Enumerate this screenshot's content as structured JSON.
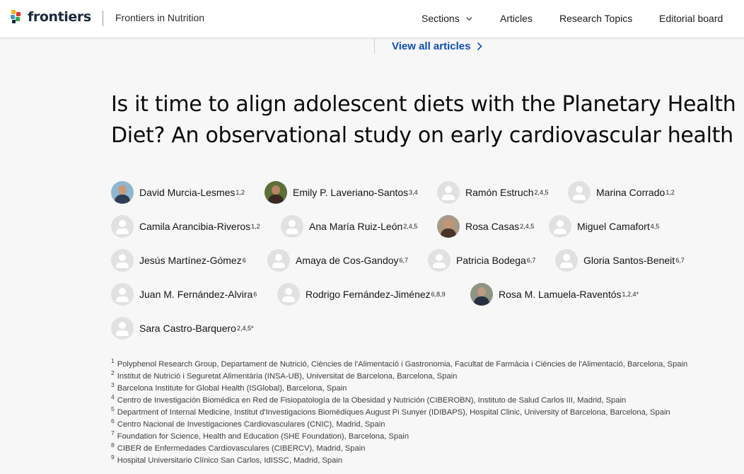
{
  "header": {
    "logo_text": "frontiers",
    "journal": "Frontiers in Nutrition",
    "nav": {
      "sections": "Sections",
      "articles": "Articles",
      "research_topics": "Research Topics",
      "editorial_board": "Editorial board"
    },
    "brand_colors": [
      "#e5352c",
      "#f6b417",
      "#3a9bd5",
      "#39a846",
      "#1c2a3a"
    ]
  },
  "view_all": "View all articles",
  "article": {
    "title": "Is it time to align adolescent diets with the Planetary Health Diet? An observational study on early cardiovascular health"
  },
  "authors": [
    {
      "name": "David Murcia-Lesmes",
      "aff": "1,2",
      "avatar": "photo"
    },
    {
      "name": "Emily P. Laveriano-Santos",
      "aff": "3,4",
      "avatar": "photo"
    },
    {
      "name": "Ramón Estruch",
      "aff": "2,4,5",
      "avatar": "placeholder"
    },
    {
      "name": "Marina Corrado",
      "aff": "1,2",
      "avatar": "placeholder"
    },
    {
      "name": "Camila Arancibia-Riveros",
      "aff": "1,2",
      "avatar": "placeholder"
    },
    {
      "name": "Ana María Ruiz-León",
      "aff": "2,4,5",
      "avatar": "placeholder"
    },
    {
      "name": "Rosa Casas",
      "aff": "2,4,5",
      "avatar": "photo"
    },
    {
      "name": "Miguel Camafort",
      "aff": "4,5",
      "avatar": "placeholder"
    },
    {
      "name": "Jesús Martínez-Gómez",
      "aff": "6",
      "avatar": "placeholder"
    },
    {
      "name": "Amaya de Cos-Gandoy",
      "aff": "6,7",
      "avatar": "placeholder"
    },
    {
      "name": "Patricia Bodega",
      "aff": "6,7",
      "avatar": "placeholder"
    },
    {
      "name": "Gloria Santos-Beneit",
      "aff": "6,7",
      "avatar": "placeholder"
    },
    {
      "name": "Juan M. Fernández-Alvira",
      "aff": "6",
      "avatar": "placeholder"
    },
    {
      "name": "Rodrigo Fernández-Jiménez",
      "aff": "6,8,9",
      "avatar": "placeholder"
    },
    {
      "name": "Rosa M. Lamuela-Raventós",
      "aff": "1,2,4*",
      "avatar": "photo"
    },
    {
      "name": "Sara Castro-Barquero",
      "aff": "2,4,5*",
      "avatar": "placeholder"
    }
  ],
  "affiliations": [
    {
      "num": "1",
      "text": "Polyphenol Research Group, Departament de Nutrició, Ciències de l'Alimentació i Gastronomia, Facultat de Farmàcia i Ciències de l'Alimentació, Barcelona, Spain"
    },
    {
      "num": "2",
      "text": "Institut de Nutrició i Seguretat Alimentària (INSA-UB), Universitat de Barcelona, Barcelona, Spain"
    },
    {
      "num": "3",
      "text": "Barcelona Institute for Global Health (ISGlobal), Barcelona, Spain"
    },
    {
      "num": "4",
      "text": "Centro de Investigación Biomédica en Red de Fisiopatología de la Obesidad y Nutrición (CIBEROBN), Instituto de Salud Carlos III, Madrid, Spain"
    },
    {
      "num": "5",
      "text": "Department of Internal Medicine, Institut d'Investigacions Biomèdiques August Pi Sunyer (IDIBAPS), Hospital Clinic, University of Barcelona, Barcelona, Spain"
    },
    {
      "num": "6",
      "text": "Centro Nacional de Investigaciones Cardiovasculares (CNIC), Madrid, Spain"
    },
    {
      "num": "7",
      "text": "Foundation for Science, Health and Education (SHE Foundation), Barcelona, Spain"
    },
    {
      "num": "8",
      "text": "CIBER de Enfermedades Cardiovasculares (CIBERCV), Madrid, Spain"
    },
    {
      "num": "9",
      "text": "Hospital Universitario Clínico San Carlos, IdISSC, Madrid, Spain"
    }
  ]
}
